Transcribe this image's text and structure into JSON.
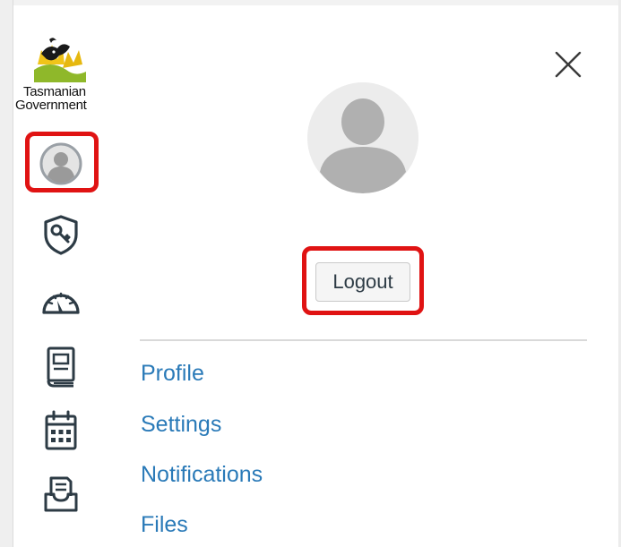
{
  "logo": {
    "line1": "Tasmanian",
    "line2": "Government"
  },
  "global_nav": [
    {
      "icon": "account-avatar-icon",
      "highlighted": true
    },
    {
      "icon": "admin-shield-key-icon"
    },
    {
      "icon": "dashboard-gauge-icon"
    },
    {
      "icon": "courses-book-icon"
    },
    {
      "icon": "calendar-icon"
    },
    {
      "icon": "inbox-icon"
    }
  ],
  "tray": {
    "close_icon": "close-icon",
    "logout_label": "Logout",
    "links": [
      {
        "label": "Profile"
      },
      {
        "label": "Settings"
      },
      {
        "label": "Notifications"
      },
      {
        "label": "Files"
      }
    ]
  },
  "colors": {
    "link": "#2a7ab8",
    "icon": "#2d3b45",
    "highlight": "#e01313",
    "avatar_fill": "#b0b0b0"
  }
}
